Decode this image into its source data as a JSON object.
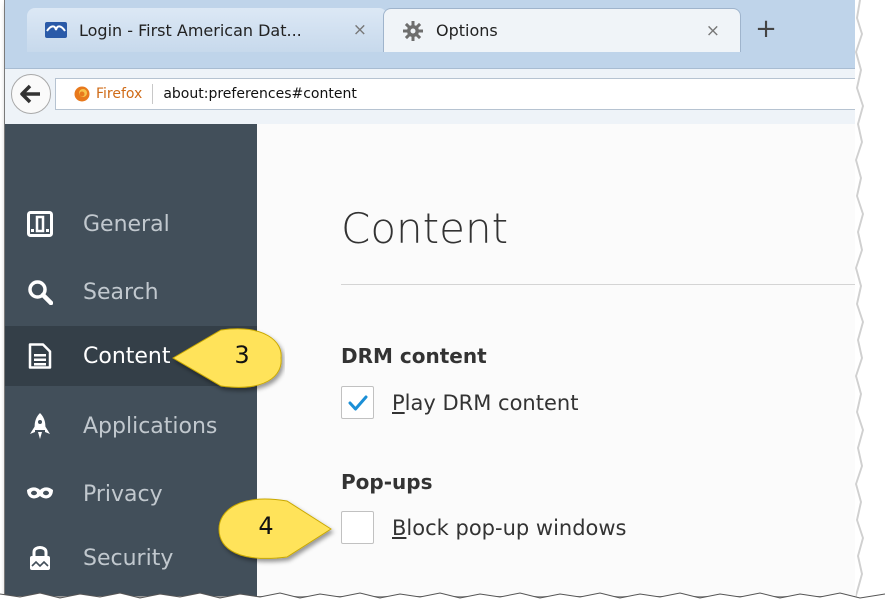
{
  "tabs": [
    {
      "title": "Login - First American Dat...",
      "close": "×",
      "favicon": "first-american-logo"
    },
    {
      "title": "Options",
      "close": "×",
      "favicon": "gear-icon"
    }
  ],
  "new_tab_label": "+",
  "navbar": {
    "identity_label": "Firefox",
    "url": "about:preferences#content"
  },
  "sidebar": {
    "items": [
      {
        "label": "General",
        "icon": "general-icon"
      },
      {
        "label": "Search",
        "icon": "search-icon"
      },
      {
        "label": "Content",
        "icon": "document-icon",
        "selected": true
      },
      {
        "label": "Applications",
        "icon": "rocket-icon"
      },
      {
        "label": "Privacy",
        "icon": "mask-icon"
      },
      {
        "label": "Security",
        "icon": "lock-icon"
      }
    ]
  },
  "main": {
    "title": "Content",
    "drm": {
      "caption": "DRM content",
      "checkbox": {
        "accesskey": "P",
        "label_rest": "lay DRM content",
        "checked": true
      }
    },
    "popups": {
      "caption": "Pop-ups",
      "checkbox": {
        "accesskey": "B",
        "label_rest": "lock pop-up windows",
        "checked": false
      }
    }
  },
  "callouts": [
    {
      "number": "3"
    },
    {
      "number": "4"
    }
  ],
  "colors": {
    "sidebar_bg": "#424f5a",
    "sidebar_selected": "#343f48",
    "checkmark": "#1b8fd6",
    "callout_fill": "#ffe35a",
    "firefox_orange": "#e8791c"
  }
}
